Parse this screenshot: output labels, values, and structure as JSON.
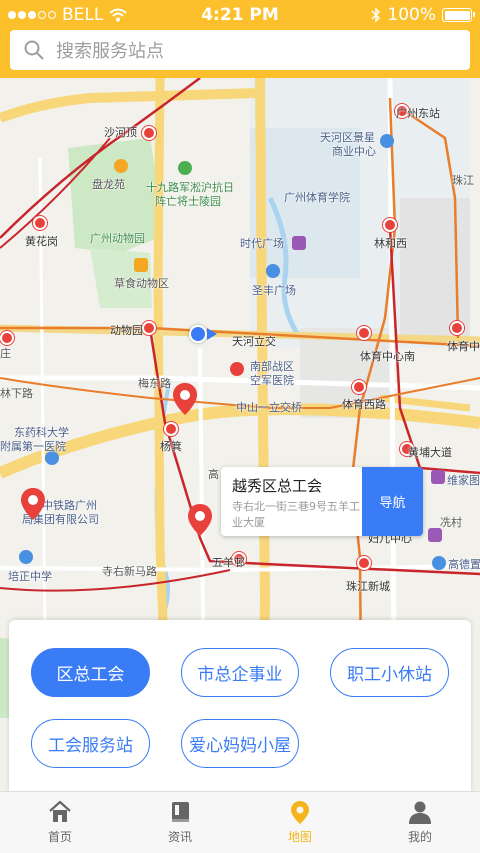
{
  "status_bar": {
    "carrier": "BELL",
    "time": "4:21 PM",
    "battery": "100%"
  },
  "search": {
    "placeholder": "搜索服务站点"
  },
  "map": {
    "labels": {
      "shahe": "沙河顶",
      "panlongyuan": "盘龙苑",
      "shijiu_1": "十九路军淞沪抗日",
      "shijiu_2": "阵亡将士陵园",
      "huanghuagang": "黄花岗",
      "zoo_park": "广州动物园",
      "caoyuan": "草食动物区",
      "zoo_station": "动物园",
      "tianhe_1": "天河区景星",
      "tianhe_2": "商业中心",
      "guangzhou_east": "广州东站",
      "zhujiang_lbl": "珠江",
      "sports_college": "广州体育学院",
      "times_square": "时代广场",
      "linhe_west": "林和西",
      "shengfeng": "圣丰广场",
      "tianhe_lijiao": "天河立交",
      "nanbu_1": "南部战区",
      "nanbu_2": "空军医院",
      "sports_center_south": "体育中心南",
      "sports_center": "体育中心",
      "meidong": "梅东路",
      "zhongshan": "中山一立交桥",
      "sports_west": "体育西路",
      "pharm_1": "东药科大学",
      "pharm_2": "附属第一医院",
      "zhuang": "庄",
      "linxia": "林下路",
      "yanghe": "杨箕",
      "huangpu": "黄埔大道",
      "weijia": "维家图",
      "railway_1": "中铁路广州",
      "railway_2": "局集团有限公司",
      "gao": "高",
      "xiancun": "冼村",
      "fuyu": "妇儿中心",
      "gaode": "高德置",
      "peizheng": "培正中学",
      "siyou": "寺右新马路",
      "wuyangcun": "五羊邨",
      "zhujiang_new": "珠江新城"
    },
    "popup": {
      "name": "越秀区总工会",
      "address": "寺右北一街三巷9号五羊工业大厦",
      "nav_label": "导航"
    }
  },
  "categories": [
    {
      "label": "区总工会",
      "active": true
    },
    {
      "label": "市总企事业",
      "active": false
    },
    {
      "label": "职工小休站",
      "active": false
    },
    {
      "label": "工会服务站",
      "active": false
    },
    {
      "label": "爱心妈妈小屋",
      "active": false
    }
  ],
  "tabs": [
    {
      "label": "首页",
      "icon": "home-icon"
    },
    {
      "label": "资讯",
      "icon": "book-icon"
    },
    {
      "label": "地图",
      "icon": "map-pin-icon",
      "active": true
    },
    {
      "label": "我的",
      "icon": "user-icon"
    }
  ],
  "colors": {
    "header": "#fcc02c",
    "primary": "#3a7cf5",
    "active_tab": "#f5b51a",
    "metro": "#e8403b"
  }
}
